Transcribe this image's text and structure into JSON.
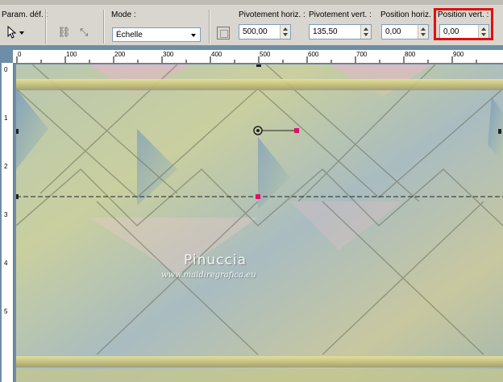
{
  "toolbar": {
    "preset_label": "Param. déf. :",
    "mode_label": "Mode :",
    "mode_value": "Échelle",
    "pivot_h_label": "Pivotement horiz. :",
    "pivot_h_value": "500,00",
    "pivot_v_label": "Pivotement vert. :",
    "pivot_v_value": "135,50",
    "pos_h_label": "Position horiz. :",
    "pos_h_value": "0,00",
    "pos_v_label": "Position vert. :",
    "pos_v_value": "0,00"
  },
  "ruler": {
    "h_ticks": [
      "0",
      "100",
      "200",
      "300",
      "400",
      "500",
      "600",
      "700",
      "800",
      "900"
    ],
    "v_ticks": [
      "0",
      "1",
      "2",
      "3",
      "4",
      "5"
    ]
  },
  "canvas": {
    "watermark_name": "Pinuccia",
    "watermark_url": "www.maidiregrafica.eu"
  },
  "colors": {
    "highlight": "#e01010",
    "handle": "#e0106a"
  }
}
